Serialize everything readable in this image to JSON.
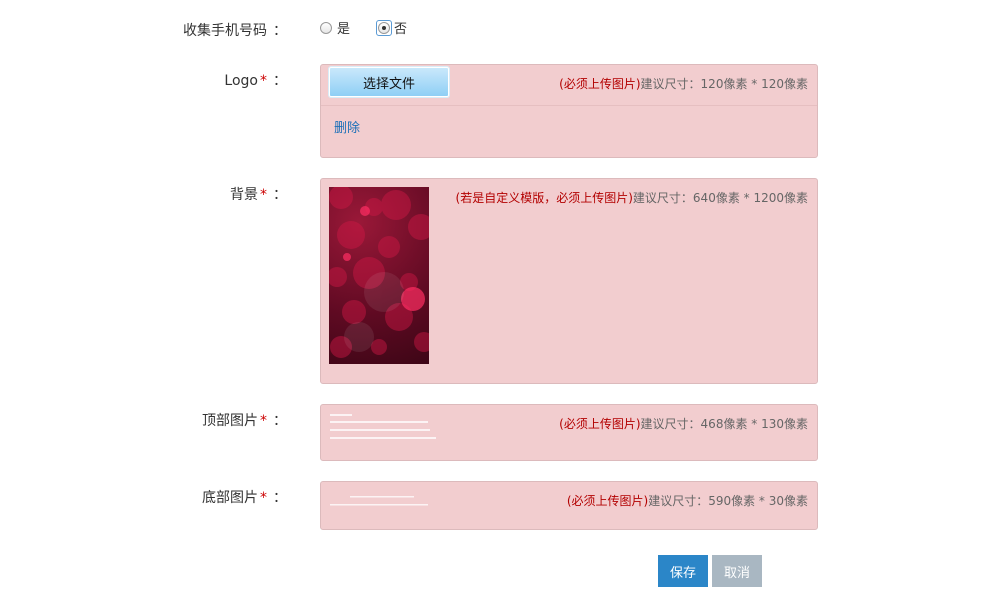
{
  "collect_phone": {
    "label": "收集手机号码",
    "colon": "：",
    "options": [
      "是",
      "否"
    ],
    "selected": "否"
  },
  "logo": {
    "label": "Logo",
    "required_mark": "*",
    "colon": "：",
    "file_button": "选择文件",
    "hint_must": "(必须上传图片)",
    "hint_size": "建议尺寸：120像素 * 120像素",
    "delete_link": "删除"
  },
  "background": {
    "label": "背景",
    "required_mark": "*",
    "colon": "：",
    "hint_must": "(若是自定义模版，必须上传图片)",
    "hint_size": "建议尺寸：640像素 * 1200像素"
  },
  "top_image": {
    "label": "顶部图片",
    "required_mark": "*",
    "colon": "：",
    "hint_must": "(必须上传图片)",
    "hint_size": "建议尺寸：468像素 * 130像素"
  },
  "bottom_image": {
    "label": "底部图片",
    "required_mark": "*",
    "colon": "：",
    "hint_must": "(必须上传图片)",
    "hint_size": "建议尺寸：590像素 * 30像素"
  },
  "actions": {
    "save": "保存",
    "cancel": "取消"
  },
  "colors": {
    "panel_bg": "#f2cdcf",
    "required": "#cc0000",
    "hint_must": "#b30000",
    "link": "#1b6fb8",
    "save_btn": "#2b86c8",
    "cancel_btn": "#a9b7c2"
  }
}
